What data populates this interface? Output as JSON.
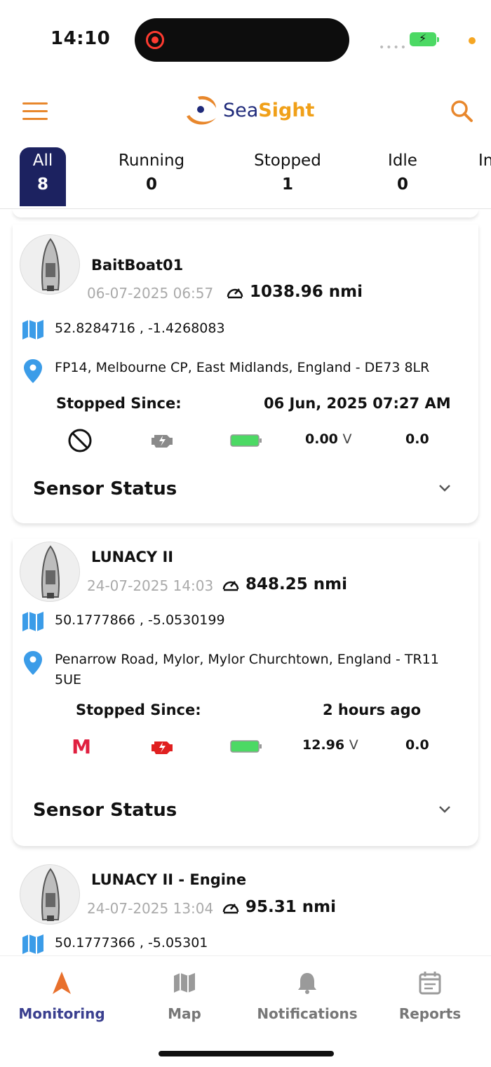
{
  "status_bar": {
    "time": "14:10"
  },
  "header": {
    "logo_sea": "Sea",
    "logo_sight": "Sight"
  },
  "tabs": [
    {
      "label": "All",
      "count": "8",
      "active": true
    },
    {
      "label": "Running",
      "count": "0"
    },
    {
      "label": "Stopped",
      "count": "1"
    },
    {
      "label": "Idle",
      "count": "0"
    },
    {
      "label": "In",
      "count": ""
    }
  ],
  "vessels": [
    {
      "name": "BaitBoat01",
      "date": "06-07-2025 06:57",
      "distance": "1038.96 nmi",
      "coords": "52.8284716 , -1.4268083",
      "address": "FP14, Melbourne CP, East Midlands, England - DE73 8LR",
      "since_label": "Stopped Since:",
      "since_value": "06 Jun, 2025 07:27 AM",
      "mode_icon": "no-entry-icon",
      "engine_color": "#8a8a8a",
      "voltage": "0.00",
      "voltage_unit": "V",
      "extra": "0.0",
      "sensor_label": "Sensor Status"
    },
    {
      "name": "LUNACY II",
      "date": "24-07-2025 14:03",
      "distance": "848.25 nmi",
      "coords": "50.1777866 , -5.0530199",
      "address": "Penarrow Road, Mylor, Mylor Churchtown, England - TR11 5UE",
      "since_label": "Stopped Since:",
      "since_value": "2 hours ago",
      "mode_letter": "M",
      "engine_color": "#e02020",
      "voltage": "12.96",
      "voltage_unit": "V",
      "extra": "0.0",
      "sensor_label": "Sensor Status"
    },
    {
      "name": "LUNACY II - Engine",
      "date": "24-07-2025 13:04",
      "distance": "95.31 nmi",
      "coords": "50.1777366 , -5.05301"
    }
  ],
  "bottom_nav": [
    {
      "label": "Monitoring",
      "icon": "navigation-arrow-icon",
      "active": true
    },
    {
      "label": "Map",
      "icon": "map-icon"
    },
    {
      "label": "Notifications",
      "icon": "bell-icon"
    },
    {
      "label": "Reports",
      "icon": "calendar-report-icon"
    }
  ],
  "colors": {
    "brand_navy": "#1c2260",
    "brand_orange": "#e8872c",
    "map_blue": "#3b9ce8",
    "battery_green": "#4cd964"
  }
}
